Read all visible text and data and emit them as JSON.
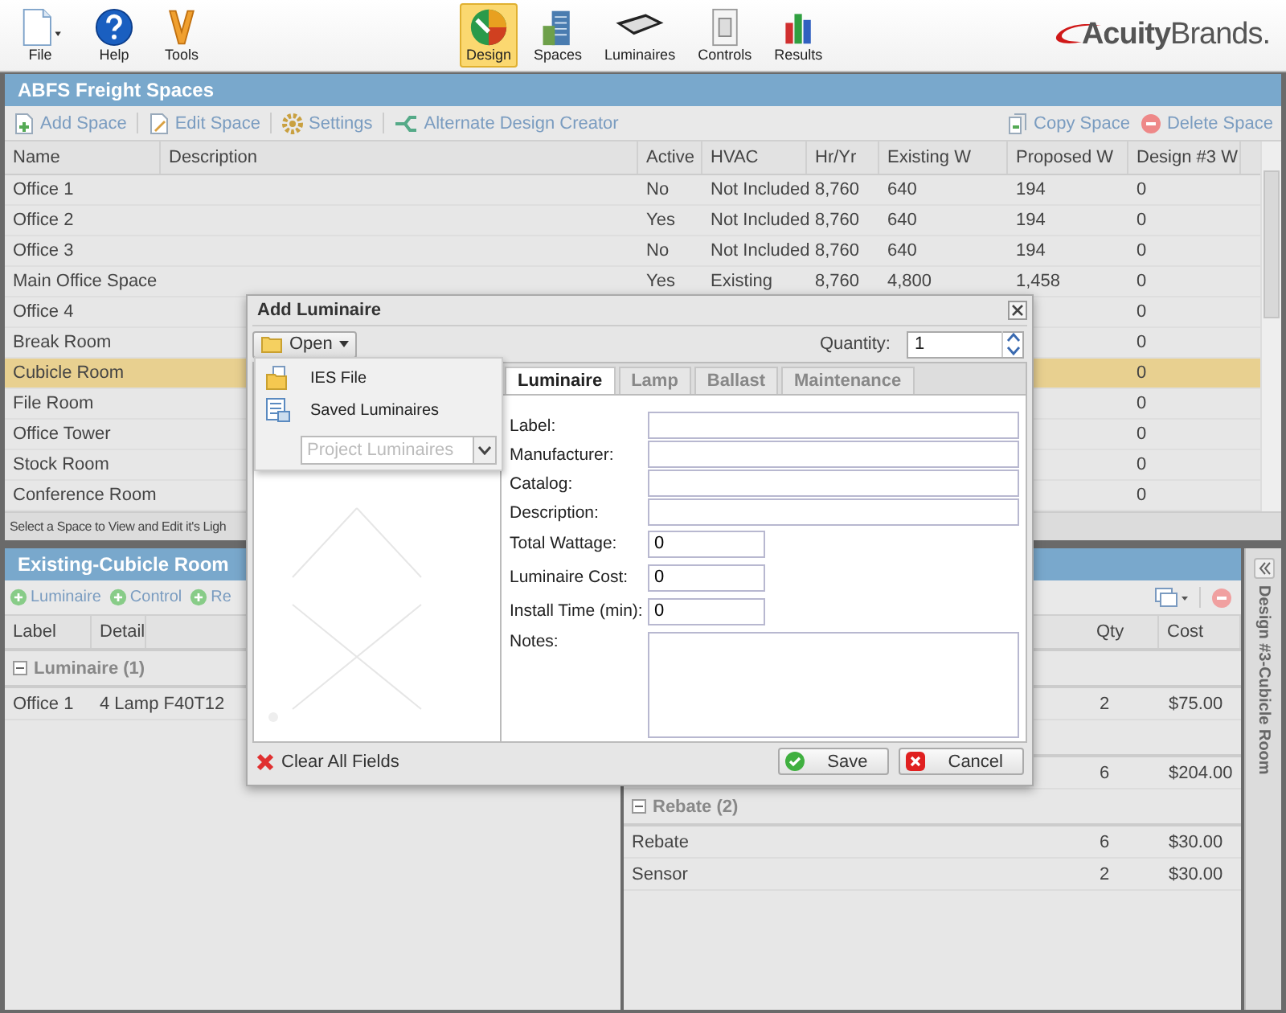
{
  "app_toolbar": {
    "left": [
      {
        "label": "File",
        "kind": "file"
      },
      {
        "label": "Help",
        "kind": "help"
      },
      {
        "label": "Tools",
        "kind": "tools"
      }
    ],
    "center": [
      {
        "label": "Design",
        "kind": "design",
        "selected": true
      },
      {
        "label": "Spaces",
        "kind": "spaces",
        "selected": false
      },
      {
        "label": "Luminaires",
        "kind": "luminaires",
        "selected": false
      },
      {
        "label": "Controls",
        "kind": "controls",
        "selected": false
      },
      {
        "label": "Results",
        "kind": "results",
        "selected": false
      }
    ],
    "logo": "**Acuity**Brands."
  },
  "spaces_panel": {
    "title": "ABFS Freight Spaces",
    "actions_left": [
      {
        "label": "Add Space",
        "kind": "add"
      },
      {
        "label": "Edit Space",
        "kind": "edit"
      },
      {
        "label": "Settings",
        "kind": "settings"
      },
      {
        "label": "Alternate Design Creator",
        "kind": "alternate"
      }
    ],
    "actions_right": [
      {
        "label": "Copy Space",
        "kind": "copy"
      },
      {
        "label": "Delete Space",
        "kind": "delete"
      }
    ],
    "columns": [
      "Name",
      "Description",
      "Active",
      "HVAC",
      "Hr/Yr",
      "Existing W",
      "Proposed W",
      "Design #3 W"
    ],
    "rows": [
      {
        "name": "Office 1",
        "active": "No",
        "hvac": "Not Included",
        "hr_yr": "8,760",
        "existing_w": "640",
        "proposed_w": "194",
        "design_3_w": "0",
        "selected": false
      },
      {
        "name": "Office 2",
        "active": "Yes",
        "hvac": "Not Included",
        "hr_yr": "8,760",
        "existing_w": "640",
        "proposed_w": "194",
        "design_3_w": "0",
        "selected": false
      },
      {
        "name": "Office 3",
        "active": "No",
        "hvac": "Not Included",
        "hr_yr": "8,760",
        "existing_w": "640",
        "proposed_w": "194",
        "design_3_w": "0",
        "selected": false
      },
      {
        "name": "Main Office Space",
        "active": "Yes",
        "hvac": "Existing",
        "hr_yr": "8,760",
        "existing_w": "4,800",
        "proposed_w": "1,458",
        "design_3_w": "0",
        "selected": false
      },
      {
        "name": "Office 4",
        "design_3_w": "0",
        "selected": false
      },
      {
        "name": "Break Room",
        "design_3_w": "0",
        "selected": false
      },
      {
        "name": "Cubicle Room",
        "design_3_w": "0",
        "selected": true
      },
      {
        "name": "File Room",
        "design_3_w": "0",
        "selected": false
      },
      {
        "name": "Office Tower",
        "design_3_w": "0",
        "selected": false
      },
      {
        "name": "Stock Room",
        "design_3_w": "0",
        "selected": false
      },
      {
        "name": "Conference Room",
        "design_3_w": "0",
        "selected": false
      }
    ],
    "status": "Select a Space to View and Edit it's Ligh"
  },
  "existing_panel": {
    "title": "Existing-Cubicle Room",
    "actions": [
      "Luminaire",
      "Control",
      "Re"
    ],
    "columns": [
      "Label",
      "Detail"
    ],
    "groups": [
      {
        "title": "Luminaire (1)",
        "expanded": true,
        "rows": [
          {
            "label": "Office 1",
            "detail": "4 Lamp F40T12"
          }
        ]
      }
    ]
  },
  "design_panel": {
    "columns": [
      "Qty",
      "Cost"
    ],
    "items": [
      {
        "kind": "group"
      },
      {
        "kind": "row",
        "qty": "2",
        "cost": "$75.00"
      },
      {
        "kind": "group"
      },
      {
        "kind": "row",
        "qty": "6",
        "cost": "$204.00"
      },
      {
        "kind": "group",
        "title": "Rebate (2)",
        "expanded": true
      },
      {
        "kind": "row",
        "label": "Rebate",
        "qty": "6",
        "cost": "$30.00"
      },
      {
        "kind": "row",
        "label": "Sensor",
        "qty": "2",
        "cost": "$30.00"
      }
    ]
  },
  "side_tab": {
    "label": "Design #3-Cubicle Room"
  },
  "dialog": {
    "title": "Add Luminaire",
    "open_button": "Open",
    "quantity_label": "Quantity:",
    "quantity": "1",
    "open_menu": {
      "items": [
        {
          "label": "IES File",
          "kind": "ies"
        },
        {
          "label": "Saved Luminaires",
          "kind": "saved"
        }
      ],
      "source_placeholder": "Project Luminaires"
    },
    "tabs": [
      {
        "label": "Luminaire",
        "selected": true
      },
      {
        "label": "Lamp",
        "selected": false
      },
      {
        "label": "Ballast",
        "selected": false
      },
      {
        "label": "Maintenance",
        "selected": false
      }
    ],
    "fields": [
      {
        "label": "Label:",
        "kind": "wide"
      },
      {
        "label": "Manufacturer:",
        "kind": "wide"
      },
      {
        "label": "Catalog:",
        "kind": "wide"
      },
      {
        "label": "Description:",
        "kind": "wide"
      },
      {
        "label": "Total Wattage:",
        "kind": "short",
        "value": "0"
      },
      {
        "label": "Luminaire Cost:",
        "kind": "short",
        "value": "0"
      },
      {
        "label": "Install Time (min):",
        "kind": "short",
        "value": "0"
      },
      {
        "label": "Notes:",
        "kind": "notes"
      }
    ],
    "clear_button": "Clear All Fields",
    "save_button": "Save",
    "cancel_button": "Cancel"
  }
}
